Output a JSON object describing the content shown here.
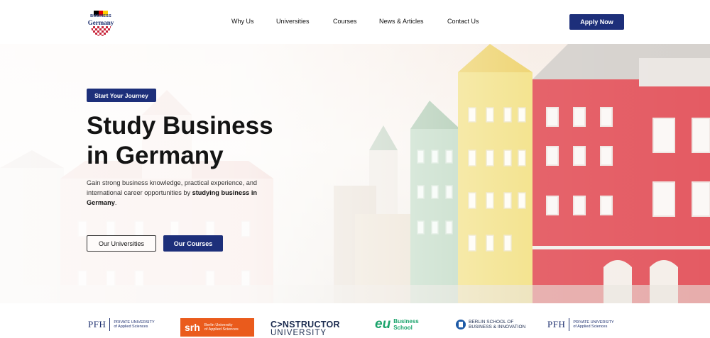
{
  "brand": {
    "line1": "BUSINESS",
    "line2": "Germany",
    "flag_colors": [
      "#000000",
      "#dd0000",
      "#ffce00"
    ]
  },
  "nav": {
    "items": [
      "Why Us",
      "Universities",
      "Courses",
      "News & Articles",
      "Contact Us"
    ],
    "cta": "Apply Now"
  },
  "hero": {
    "tag": "Start Your Journey",
    "title_line1": "Study Business",
    "title_line2": "in Germany",
    "desc_part1": "Gain strong business knowledge, practical experience, and international career opportunities by ",
    "desc_bold": "studying business in Germany",
    "desc_end": ".",
    "btn_universities": "Our Universities",
    "btn_courses": "Our Courses"
  },
  "partners": {
    "pfh": {
      "mark": "PFH",
      "line1": "PRIVATE UNIVERSITY",
      "line2": "of Applied Sciences"
    },
    "srh": {
      "mark": "srh",
      "line1": "Berlin University",
      "line2": "of Applied Sciences"
    },
    "constructor": {
      "line1": "C>NSTRUCTOR",
      "line2": "UNIVERSITY"
    },
    "eu": {
      "mark": "eu",
      "line1": "Business",
      "line2": "School"
    },
    "bsbi": {
      "line1": "BERLIN SCHOOL OF",
      "line2": "BUSINESS & INNOVATION"
    },
    "pfh2": {
      "mark": "PFH",
      "line1": "PRIVATE UNIVERSITY",
      "line2": "of Applied Sciences"
    }
  },
  "colors": {
    "primary": "#1d2f7a",
    "srh_orange": "#ea5b1c",
    "eu_green": "#1aa36b"
  }
}
